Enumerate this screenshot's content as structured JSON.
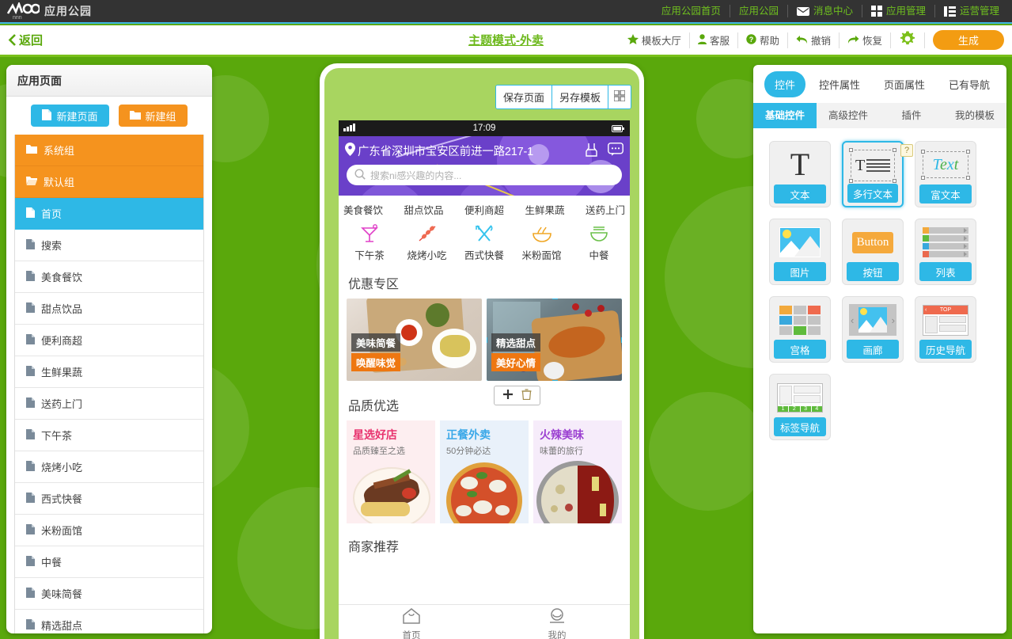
{
  "topbar": {
    "brand_text": "应用公园",
    "nav": [
      {
        "label": "应用公园首页",
        "icon": ""
      },
      {
        "label": "应用公园",
        "icon": ""
      },
      {
        "label": "消息中心",
        "icon": "mail-icon"
      },
      {
        "label": "应用管理",
        "icon": "grid-icon"
      },
      {
        "label": "运营管理",
        "icon": "list-icon"
      }
    ]
  },
  "toolbar": {
    "back_label": "返回",
    "doc_title": "主题模式-外卖",
    "items": [
      {
        "label": "模板大厅",
        "icon": "star-icon"
      },
      {
        "label": "客服",
        "icon": "user-icon"
      },
      {
        "label": "帮助",
        "icon": "question-icon"
      },
      {
        "label": "撤销",
        "icon": "undo-icon"
      },
      {
        "label": "恢复",
        "icon": "redo-icon"
      }
    ],
    "settings_icon": "gear-icon",
    "generate_label": "生成"
  },
  "left_panel": {
    "header": "应用页面",
    "new_page_label": "新建页面",
    "new_group_label": "新建组",
    "items": [
      {
        "label": "系统组",
        "type": "group",
        "icon": "folder-icon"
      },
      {
        "label": "默认组",
        "type": "group",
        "icon": "folder-open-icon"
      },
      {
        "label": "首页",
        "type": "page",
        "icon": "page-icon",
        "active": true
      },
      {
        "label": "搜索",
        "type": "page",
        "icon": "page-icon"
      },
      {
        "label": "美食餐饮",
        "type": "page",
        "icon": "page-icon"
      },
      {
        "label": "甜点饮品",
        "type": "page",
        "icon": "page-icon"
      },
      {
        "label": "便利商超",
        "type": "page",
        "icon": "page-icon"
      },
      {
        "label": "生鲜果蔬",
        "type": "page",
        "icon": "page-icon"
      },
      {
        "label": "送药上门",
        "type": "page",
        "icon": "page-icon"
      },
      {
        "label": "下午茶",
        "type": "page",
        "icon": "page-icon"
      },
      {
        "label": "烧烤小吃",
        "type": "page",
        "icon": "page-icon"
      },
      {
        "label": "西式快餐",
        "type": "page",
        "icon": "page-icon"
      },
      {
        "label": "米粉面馆",
        "type": "page",
        "icon": "page-icon"
      },
      {
        "label": "中餐",
        "type": "page",
        "icon": "page-icon"
      },
      {
        "label": "美味简餐",
        "type": "page",
        "icon": "page-icon"
      },
      {
        "label": "精选甜点",
        "type": "page",
        "icon": "page-icon"
      }
    ]
  },
  "phone": {
    "save_page_label": "保存页面",
    "save_template_label": "另存模板",
    "grid_icon": "qr-grid-icon",
    "status_time": "17:09",
    "address": "广东省深圳市宝安区前进一路217-1",
    "location_icon": "location-pin-icon",
    "header_icons": [
      "scan-icon",
      "chat-icon"
    ],
    "search_placeholder": "搜索ni感兴趣的内容...",
    "search_icon": "search-icon",
    "categories": [
      "美食餐饮",
      "甜点饮品",
      "便利商超",
      "生鲜果蔬",
      "送药上门"
    ],
    "quick_icons": [
      {
        "label": "下午茶",
        "icon": "cocktail-icon",
        "color": "#e040c8"
      },
      {
        "label": "烧烤小吃",
        "icon": "skewer-icon",
        "color": "#e8453c"
      },
      {
        "label": "西式快餐",
        "icon": "fork-knife-icon",
        "color": "#35c3ed"
      },
      {
        "label": "米粉面馆",
        "icon": "noodle-bowl-icon",
        "color": "#f0a726"
      },
      {
        "label": "中餐",
        "icon": "rice-bowl-icon",
        "color": "#6cc04a"
      }
    ],
    "promo_section_title": "优惠专区",
    "promos": [
      {
        "title": "美味简餐",
        "subtitle": "唤醒味觉",
        "selected": false
      },
      {
        "title": "精选甜点",
        "subtitle": "美好心情",
        "selected": true
      }
    ],
    "promo_tools": {
      "add_icon": "plus-icon",
      "delete_icon": "trash-icon"
    },
    "quality_section_title": "品质优选",
    "quality_cards": [
      {
        "title": "星选好店",
        "subtitle": "品质臻至之选",
        "color": "#e8336e",
        "bg": "#fdeef0"
      },
      {
        "title": "正餐外卖",
        "subtitle": "50分钟必达",
        "color": "#3aa8e8",
        "bg": "#e9f1fa"
      },
      {
        "title": "火辣美味",
        "subtitle": "味蕾的旅行",
        "color": "#9b3fd1",
        "bg": "#f6ecfa"
      }
    ],
    "merchant_section_title": "商家推荐",
    "tabs": [
      {
        "label": "首页",
        "icon": "home-icon"
      },
      {
        "label": "我的",
        "icon": "person-icon"
      }
    ]
  },
  "right_panel": {
    "tabs": [
      {
        "label": "控件",
        "active": true
      },
      {
        "label": "控件属性",
        "active": false
      },
      {
        "label": "页面属性",
        "active": false
      },
      {
        "label": "已有导航",
        "active": false
      }
    ],
    "subtabs": [
      {
        "label": "基础控件",
        "active": true
      },
      {
        "label": "高级控件",
        "active": false
      },
      {
        "label": "插件",
        "active": false
      },
      {
        "label": "我的模板",
        "active": false
      }
    ],
    "widgets": [
      {
        "label": "文本",
        "icon": "text-T-icon",
        "selected": false
      },
      {
        "label": "多行文本",
        "icon": "multiline-text-icon",
        "selected": true,
        "help_badge": "?"
      },
      {
        "label": "富文本",
        "icon": "rich-text-icon",
        "selected": false
      },
      {
        "label": "图片",
        "icon": "image-icon",
        "selected": false
      },
      {
        "label": "按钮",
        "icon": "button-icon",
        "button_text": "Button",
        "selected": false
      },
      {
        "label": "列表",
        "icon": "list-rows-icon",
        "selected": false
      },
      {
        "label": "宫格",
        "icon": "grid-cells-icon",
        "selected": false
      },
      {
        "label": "画廊",
        "icon": "gallery-icon",
        "selected": false
      },
      {
        "label": "历史导航",
        "icon": "history-nav-icon",
        "top_label": "TOP",
        "selected": false
      },
      {
        "label": "标签导航",
        "icon": "tab-nav-icon",
        "nums": "1 2 3 4",
        "selected": false
      }
    ]
  },
  "colors": {
    "canvas_green": "#5aa80c",
    "accent_blue": "#2eb8e6",
    "accent_orange": "#f5931e",
    "brand_green": "#6cb81b",
    "phone_purple": "#6a40c9"
  }
}
